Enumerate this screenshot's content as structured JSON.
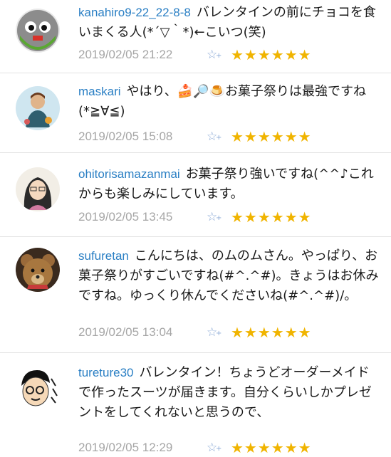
{
  "comments": [
    {
      "user": "kanahiro9-22_22-8-8",
      "text": "バレンタインの前にチョコを食いまくる人(*´▽｀*)←こいつ(笑)",
      "date": "2019/02/05 21:22",
      "stars": "★★★★★★"
    },
    {
      "user": "maskari",
      "text": "やはり、🍰🔎🍮お菓子祭りは最強ですね(*≧∀≦)",
      "date": "2019/02/05 15:08",
      "stars": "★★★★★★"
    },
    {
      "user": "ohitorisamazanmai",
      "text": "お菓子祭り強いですね(^^♪これからも楽しみにしています。",
      "date": "2019/02/05 13:45",
      "stars": "★★★★★★"
    },
    {
      "user": "sufuretan",
      "text": "こんにちは、のムのムさん。やっぱり、お菓子祭りがすごいですね(#^.^#)。きょうはお休みですね。ゆっくり休んでくださいね(#^.^#)/。",
      "date": "2019/02/05 13:04",
      "stars": "★★★★★★"
    },
    {
      "user": "tureture30",
      "text": "バレンタイン！ちょうどオーダーメイドで作ったスーツが届きます。自分くらいしかプレゼントをしてくれないと思うので、",
      "date": "2019/02/05 12:29",
      "stars": "★★★★★★"
    }
  ],
  "icons": {
    "add_star": "☆",
    "add_plus": "+"
  },
  "colors": {
    "username": "#2a7fc4",
    "star": "#f0b400",
    "date": "#a6a6a6"
  }
}
